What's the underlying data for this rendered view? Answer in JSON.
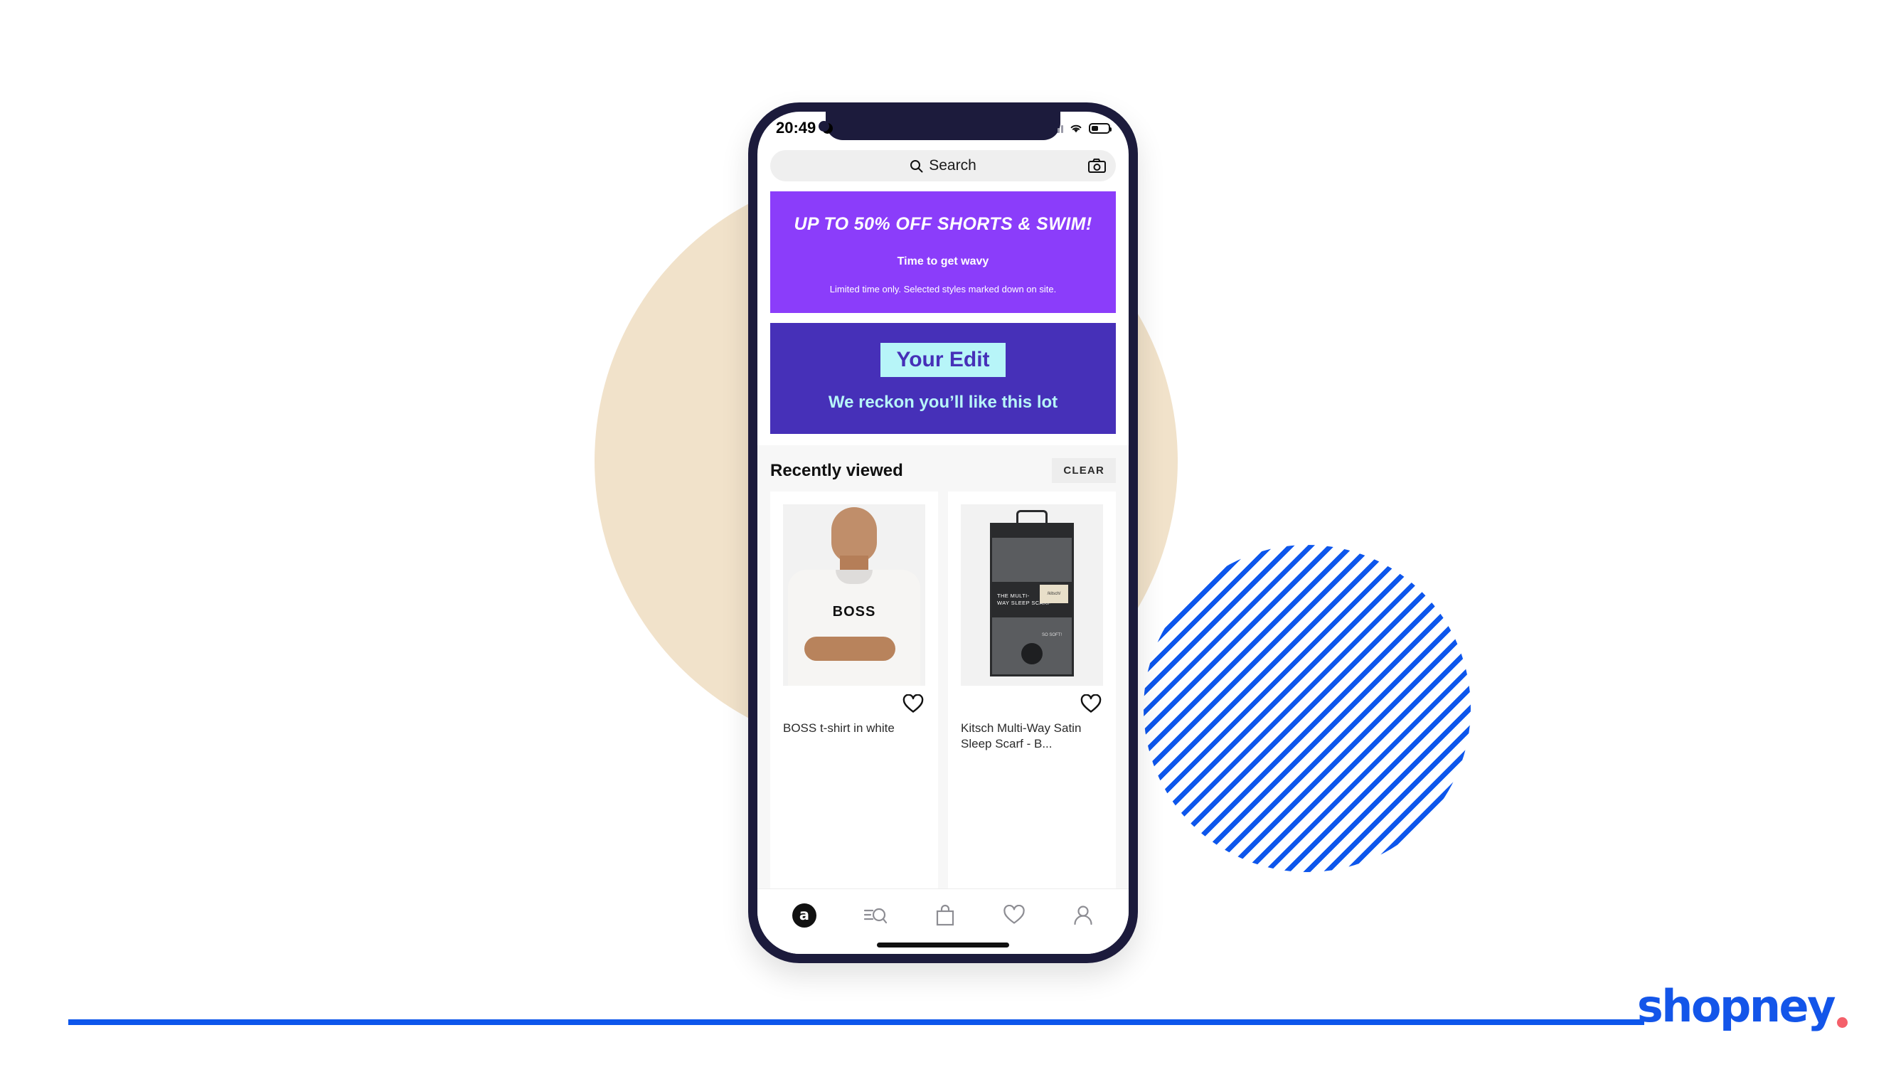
{
  "brand": {
    "logo_text": "shopney",
    "logo_color": "#1355E9",
    "dot_color": "#F4606A"
  },
  "phone": {
    "status_bar": {
      "time": "20:49",
      "dnd_icon": "moon-icon",
      "signal_icon": "signal-bars-icon",
      "wifi_icon": "wifi-icon",
      "battery_icon": "battery-icon",
      "battery_level": "42%"
    },
    "search": {
      "placeholder": "Search",
      "search_icon": "search-icon",
      "camera_icon": "camera-icon"
    },
    "promo_banner": {
      "bg_color": "#8B3DFA",
      "headline": "UP TO 50% OFF SHORTS & SWIM!",
      "subhead": "Time to get wavy",
      "terms": "Limited time only. Selected styles marked down on site."
    },
    "edit_banner": {
      "bg_color": "#4630B8",
      "chip_bg_color": "#B7F5F8",
      "chip_label": "Your Edit",
      "subtitle": "We reckon you’ll like this lot"
    },
    "recently_viewed": {
      "title": "Recently viewed",
      "clear_label": "CLEAR",
      "products": [
        {
          "title": "BOSS t-shirt in white",
          "shirt_logo": "BOSS",
          "fav_icon": "heart-icon"
        },
        {
          "title": "Kitsch Multi-Way Satin Sleep Scarf - B...",
          "package_text": "THE MULTI-\nWAY SLEEP SCARF",
          "package_brand": "/kitsch/",
          "package_note": "SO SOFT!",
          "fav_icon": "heart-icon"
        }
      ]
    },
    "tab_bar": {
      "items": [
        {
          "name": "home",
          "icon": "asos-logo-icon",
          "label": "a",
          "active": true
        },
        {
          "name": "search",
          "icon": "search-lines-icon",
          "active": false
        },
        {
          "name": "bag",
          "icon": "shopping-bag-icon",
          "active": false
        },
        {
          "name": "saved",
          "icon": "heart-icon",
          "active": false
        },
        {
          "name": "account",
          "icon": "person-icon",
          "active": false
        }
      ]
    }
  }
}
